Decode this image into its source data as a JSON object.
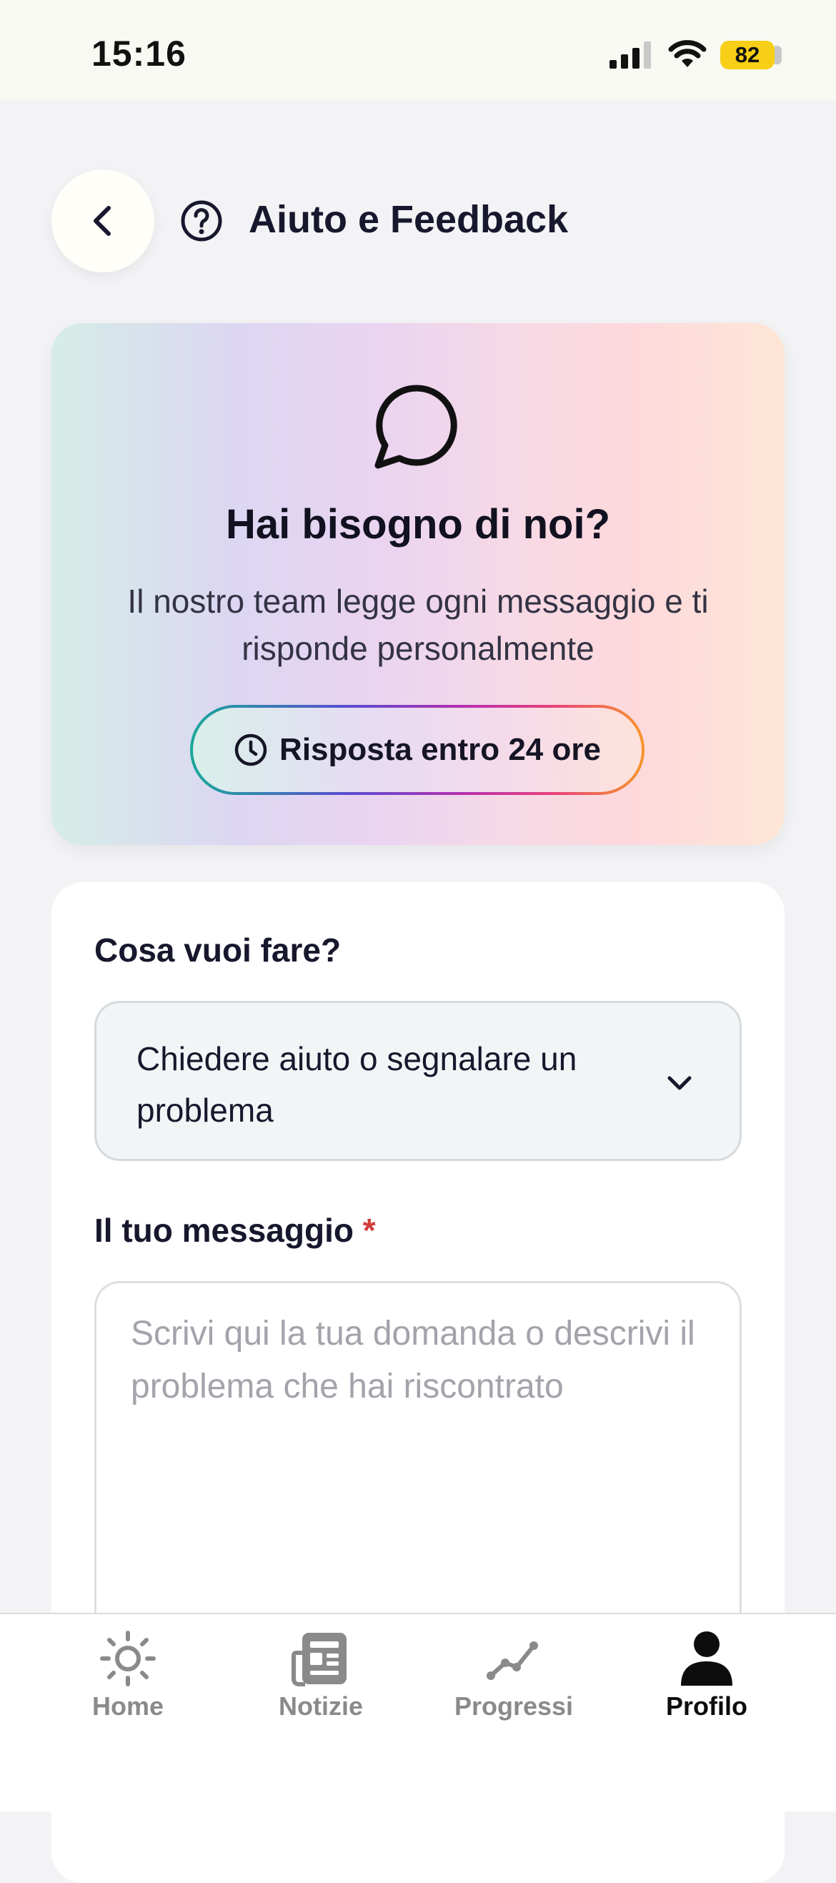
{
  "status_bar": {
    "time": "15:16",
    "battery_level": "82"
  },
  "header": {
    "title": "Aiuto e Feedback",
    "back_icon": "chevron-left-icon",
    "title_icon": "help-circle-icon"
  },
  "hero": {
    "icon": "chat-bubble-icon",
    "title": "Hai bisogno di noi?",
    "subtitle": "Il nostro team legge ogni messaggio e ti risponde personalmente",
    "response_badge": "Risposta entro 24 ore",
    "badge_icon": "clock-icon"
  },
  "form": {
    "action_label": "Cosa vuoi fare?",
    "action_selected": "Chiedere aiuto o segnalare un problema",
    "message_label": "Il tuo messaggio",
    "message_required_mark": "*",
    "message_value": "",
    "message_placeholder": "Scrivi qui la tua domanda o descrivi il problema che hai riscontrato"
  },
  "tabs": [
    {
      "label": "Home",
      "icon": "sun-icon",
      "active": false
    },
    {
      "label": "Notizie",
      "icon": "newspaper-icon",
      "active": false
    },
    {
      "label": "Progressi",
      "icon": "trend-line-icon",
      "active": false
    },
    {
      "label": "Profilo",
      "icon": "user-icon",
      "active": true
    }
  ],
  "colors": {
    "background": "#f3f3f6",
    "text_primary": "#17172d",
    "required": "#d33b3b",
    "battery": "#f6cf16",
    "tab_inactive": "#8a8a8a",
    "tab_active": "#0d0d0d"
  }
}
